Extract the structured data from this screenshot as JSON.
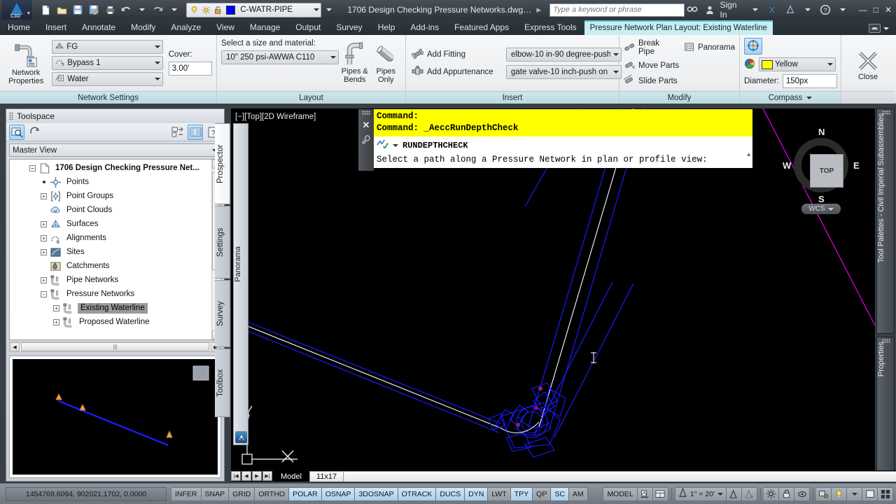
{
  "titlebar": {
    "app_name": "Autodesk Civil 3D",
    "app_badge": "C3D",
    "layer": {
      "name": "C-WATR-PIPE",
      "color_hex": "#0000ff"
    },
    "document_title": "1706 Design Checking Pressure Networks.dwg [L...",
    "search": {
      "placeholder": "Type a keyword or phrase",
      "value": ""
    },
    "sign_in": "Sign In",
    "quick_access": [
      "new-icon",
      "open-icon",
      "save-icon",
      "saveas-icon",
      "plot-icon",
      "undo-icon",
      "redo-icon"
    ],
    "layer_icons": [
      "lightbulb-icon",
      "sun-icon",
      "unlock-icon"
    ],
    "window_buttons": [
      "minimize",
      "maximize",
      "close"
    ]
  },
  "ribbon_tabs": {
    "items": [
      "Home",
      "Insert",
      "Annotate",
      "Modify",
      "Analyze",
      "View",
      "Manage",
      "Output",
      "Survey",
      "Help",
      "Add-ins",
      "Featured Apps",
      "Express Tools"
    ],
    "contextual": "Pressure Network Plan Layout: Existing Waterline",
    "active_index": 13
  },
  "ribbon": {
    "panels": [
      {
        "title": "Network Settings",
        "big_button": {
          "label_line1": "Network",
          "label_line2": "Properties",
          "icon": "network-properties-icon"
        },
        "combos": [
          {
            "label": "FG",
            "icon": "surface-icon"
          },
          {
            "label": "Bypass 1",
            "icon": "alignment-icon"
          },
          {
            "label": "Water",
            "icon": "water-icon"
          }
        ],
        "cover_label": "Cover:",
        "cover_value": "3.00'"
      },
      {
        "title": "Layout",
        "size_label": "Select a size and material:",
        "size_value": "10\" 250 psi-AWWA C110",
        "buttons": [
          {
            "line1": "Pipes &",
            "line2": "Bends",
            "icon": "pipes-and-bends-icon"
          },
          {
            "line1": "Pipes",
            "line2": "Only",
            "icon": "pipes-only-icon"
          }
        ]
      },
      {
        "title": "Insert",
        "rows": [
          {
            "label": "Add Fitting",
            "icon": "add-fitting-icon",
            "combo": "elbow-10 in-90 degree-push"
          },
          {
            "label": "Add Appurtenance",
            "icon": "add-appurtenance-icon",
            "combo": "gate valve-10 inch-push on"
          }
        ]
      },
      {
        "title": "Modify",
        "items": [
          {
            "label": "Break Pipe",
            "icon": "break-pipe-icon"
          },
          {
            "label": "Panorama",
            "icon": "panorama-icon"
          },
          {
            "label": "Move Parts",
            "icon": "move-parts-icon"
          },
          {
            "label": "Slide Parts",
            "icon": "slide-parts-icon"
          }
        ]
      },
      {
        "title": "Compass",
        "toggle_icon": "compass-toggle-icon",
        "color_label": "Yellow",
        "color_hex": "#ffff00",
        "diameter_label": "Diameter:",
        "diameter_value": "150px"
      },
      {
        "title": "",
        "close_label": "Close",
        "close_icon": "close-x-icon"
      }
    ]
  },
  "toolspace": {
    "title": "Toolspace",
    "toolbar_icons": [
      "item-preview-icon",
      "refresh-icon",
      "panel-layout-icon",
      "preview-toggle-icon",
      "help-icon"
    ],
    "view_selector": "Master View",
    "tree": [
      {
        "label": "1706 Design Checking Pressure Net...",
        "expander": "minus",
        "icon": "drawing-icon",
        "indent": 0,
        "root": true
      },
      {
        "label": "Points",
        "expander": "dot",
        "icon": "points-icon",
        "indent": 1
      },
      {
        "label": "Point Groups",
        "expander": "plus",
        "icon": "point-groups-icon",
        "indent": 1
      },
      {
        "label": "Point Clouds",
        "expander": "none",
        "icon": "point-clouds-icon",
        "indent": 1
      },
      {
        "label": "Surfaces",
        "expander": "plus",
        "icon": "surfaces-icon",
        "indent": 1
      },
      {
        "label": "Alignments",
        "expander": "plus",
        "icon": "alignments-icon",
        "indent": 1
      },
      {
        "label": "Sites",
        "expander": "plus",
        "icon": "sites-icon",
        "indent": 1
      },
      {
        "label": "Catchments",
        "expander": "none",
        "icon": "catchments-icon",
        "indent": 1
      },
      {
        "label": "Pipe Networks",
        "expander": "plus",
        "icon": "pipe-networks-icon",
        "indent": 1
      },
      {
        "label": "Pressure Networks",
        "expander": "minus",
        "icon": "pressure-networks-icon",
        "indent": 1
      },
      {
        "label": "Existing Waterline",
        "expander": "plus",
        "icon": "pressure-network-icon",
        "indent": 2,
        "selected": true
      },
      {
        "label": "Proposed Waterline",
        "expander": "plus",
        "icon": "pressure-network-icon",
        "indent": 2
      }
    ],
    "tabs": [
      "Prospector",
      "Settings",
      "Survey",
      "Toolbox"
    ],
    "active_tab": "Prospector"
  },
  "drawing": {
    "viewport_label": "[−][Top][2D Wireframe]",
    "panorama_tab": "Panorama",
    "viewcube": {
      "top_face": "TOP",
      "north": "N",
      "south": "S",
      "east": "E",
      "west": "W",
      "wcs_label": "WCS"
    },
    "layout_tabs": {
      "nav": [
        "first",
        "prev",
        "next",
        "last"
      ],
      "tabs": [
        "Model",
        "11x17"
      ],
      "active": "Model"
    }
  },
  "command_window": {
    "lines_yellow": [
      "Command:",
      "Command: _AeccRunDepthCheck"
    ],
    "command_name": "RUNDEPTHCHECK",
    "prompt": "Select a path along a Pressure Network in plan or profile view:",
    "close_icon": "close-icon",
    "wrench_icon": "customize-icon"
  },
  "right_palettes": [
    {
      "label": "Tool Palettes - Civil Imperial Subassemblies"
    },
    {
      "label": "Properties"
    }
  ],
  "statusbar": {
    "coordinates": "1454769.6094, 902021.1702, 0.0000",
    "toggles": [
      {
        "label": "INFER",
        "on": false
      },
      {
        "label": "SNAP",
        "on": false
      },
      {
        "label": "GRID",
        "on": false
      },
      {
        "label": "ORTHO",
        "on": false
      },
      {
        "label": "POLAR",
        "on": true
      },
      {
        "label": "OSNAP",
        "on": true
      },
      {
        "label": "3DOSNAP",
        "on": true
      },
      {
        "label": "OTRACK",
        "on": true
      },
      {
        "label": "DUCS",
        "on": true
      },
      {
        "label": "DYN",
        "on": true
      },
      {
        "label": "LWT",
        "on": false
      },
      {
        "label": "TPY",
        "on": true
      },
      {
        "label": "QP",
        "on": false
      },
      {
        "label": "SC",
        "on": true
      },
      {
        "label": "AM",
        "on": false
      }
    ],
    "model_label": "MODEL",
    "scale": "1\" = 20'",
    "right_icons": [
      "layout-icon",
      "viewport-icon",
      "annotation-scale-icon",
      "annotation-visibility-icon",
      "auto-scale-icon",
      "workspace-icon",
      "lock-icon",
      "hardware-icon",
      "isolate-icon",
      "status-tray-icon",
      "clean-screen-icon"
    ]
  }
}
